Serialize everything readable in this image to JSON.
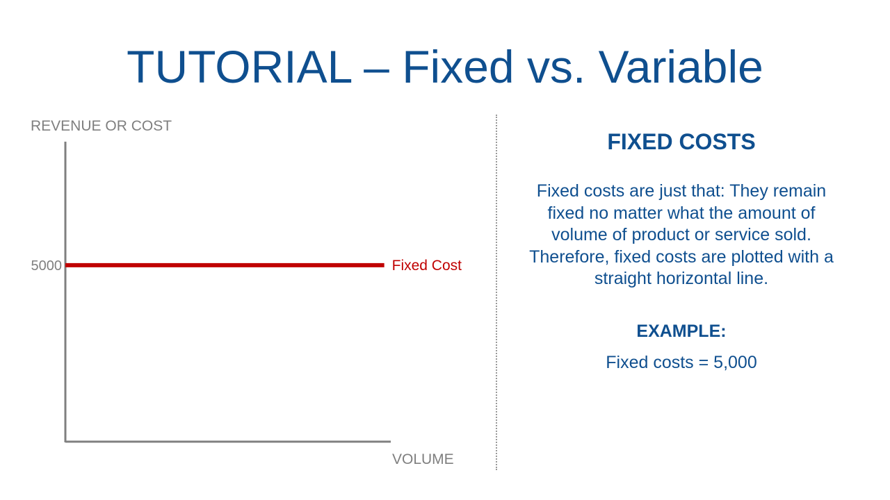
{
  "slide": {
    "title": "TUTORIAL – Fixed vs. Variable",
    "right_panel": {
      "heading": "FIXED COSTS",
      "body": "Fixed costs are just that: They remain fixed no matter what the amount of volume of product or service sold. Therefore, fixed costs are plotted with a straight horizontal line.",
      "example_label": "EXAMPLE:",
      "example_value": "Fixed costs = 5,000"
    }
  },
  "chart_data": {
    "type": "line",
    "title": "",
    "xlabel": "VOLUME",
    "ylabel": "REVENUE OR COST",
    "ylim": [
      0,
      8500
    ],
    "xlim": [
      0,
      1
    ],
    "y_ticks": [
      {
        "value": 5000,
        "label": "5000"
      }
    ],
    "grid": false,
    "series": [
      {
        "name": "Fixed Cost",
        "color": "#c00000",
        "x": [
          0,
          0.98
        ],
        "y": [
          5000,
          5000
        ]
      }
    ],
    "axis_color": "#808080"
  }
}
